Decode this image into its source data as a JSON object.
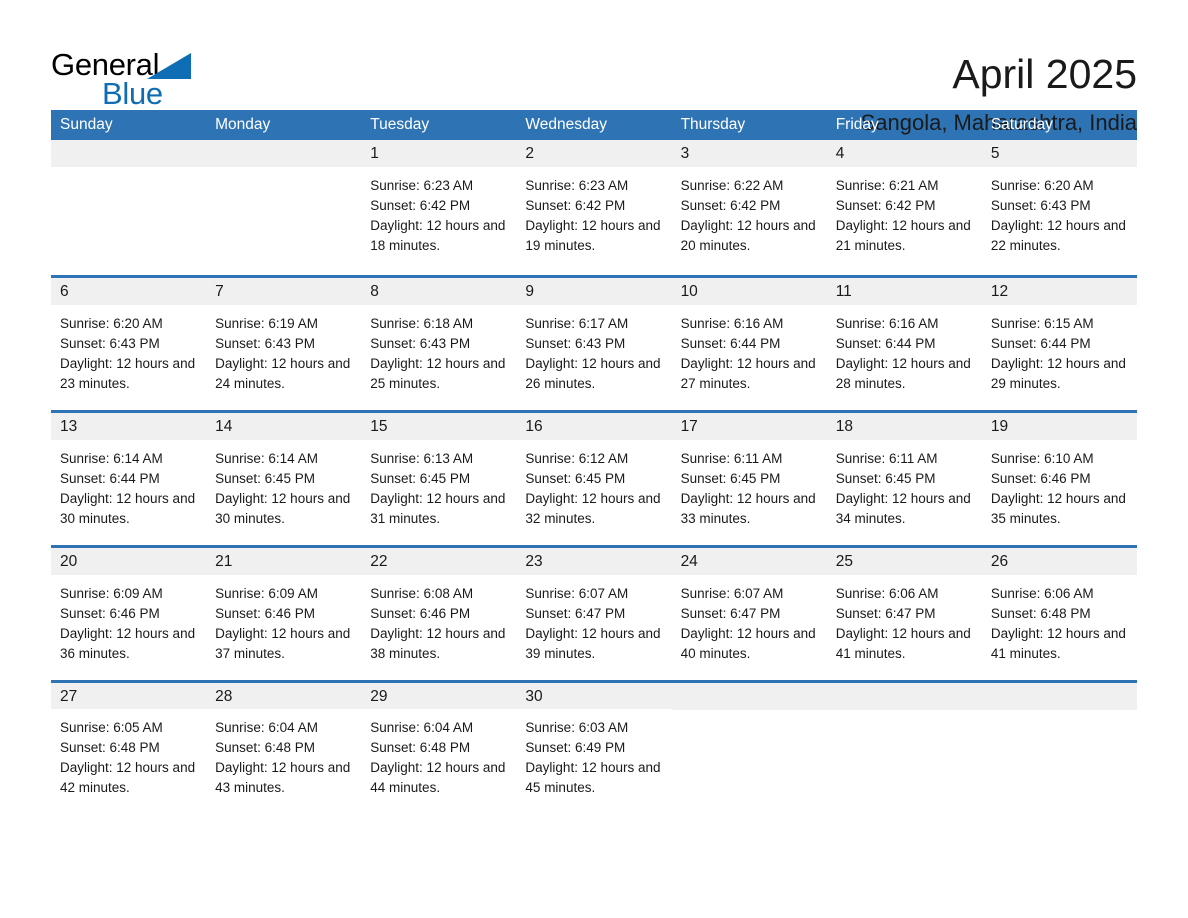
{
  "brand": {
    "logo_text_primary": "General",
    "logo_text_secondary": "Blue",
    "accent_color": "#2E74B5",
    "logo_blue": "#0F6DB5"
  },
  "header": {
    "month_title": "April 2025",
    "location": "Sangola, Maharashtra, India"
  },
  "calendar": {
    "weekday_headers": [
      "Sunday",
      "Monday",
      "Tuesday",
      "Wednesday",
      "Thursday",
      "Friday",
      "Saturday"
    ],
    "weeks": [
      [
        {
          "day": "",
          "empty": true
        },
        {
          "day": "",
          "empty": true
        },
        {
          "day": "1",
          "sunrise": "Sunrise: 6:23 AM",
          "sunset": "Sunset: 6:42 PM",
          "daylight": "Daylight: 12 hours and 18 minutes."
        },
        {
          "day": "2",
          "sunrise": "Sunrise: 6:23 AM",
          "sunset": "Sunset: 6:42 PM",
          "daylight": "Daylight: 12 hours and 19 minutes."
        },
        {
          "day": "3",
          "sunrise": "Sunrise: 6:22 AM",
          "sunset": "Sunset: 6:42 PM",
          "daylight": "Daylight: 12 hours and 20 minutes."
        },
        {
          "day": "4",
          "sunrise": "Sunrise: 6:21 AM",
          "sunset": "Sunset: 6:42 PM",
          "daylight": "Daylight: 12 hours and 21 minutes."
        },
        {
          "day": "5",
          "sunrise": "Sunrise: 6:20 AM",
          "sunset": "Sunset: 6:43 PM",
          "daylight": "Daylight: 12 hours and 22 minutes."
        }
      ],
      [
        {
          "day": "6",
          "sunrise": "Sunrise: 6:20 AM",
          "sunset": "Sunset: 6:43 PM",
          "daylight": "Daylight: 12 hours and 23 minutes."
        },
        {
          "day": "7",
          "sunrise": "Sunrise: 6:19 AM",
          "sunset": "Sunset: 6:43 PM",
          "daylight": "Daylight: 12 hours and 24 minutes."
        },
        {
          "day": "8",
          "sunrise": "Sunrise: 6:18 AM",
          "sunset": "Sunset: 6:43 PM",
          "daylight": "Daylight: 12 hours and 25 minutes."
        },
        {
          "day": "9",
          "sunrise": "Sunrise: 6:17 AM",
          "sunset": "Sunset: 6:43 PM",
          "daylight": "Daylight: 12 hours and 26 minutes."
        },
        {
          "day": "10",
          "sunrise": "Sunrise: 6:16 AM",
          "sunset": "Sunset: 6:44 PM",
          "daylight": "Daylight: 12 hours and 27 minutes."
        },
        {
          "day": "11",
          "sunrise": "Sunrise: 6:16 AM",
          "sunset": "Sunset: 6:44 PM",
          "daylight": "Daylight: 12 hours and 28 minutes."
        },
        {
          "day": "12",
          "sunrise": "Sunrise: 6:15 AM",
          "sunset": "Sunset: 6:44 PM",
          "daylight": "Daylight: 12 hours and 29 minutes."
        }
      ],
      [
        {
          "day": "13",
          "sunrise": "Sunrise: 6:14 AM",
          "sunset": "Sunset: 6:44 PM",
          "daylight": "Daylight: 12 hours and 30 minutes."
        },
        {
          "day": "14",
          "sunrise": "Sunrise: 6:14 AM",
          "sunset": "Sunset: 6:45 PM",
          "daylight": "Daylight: 12 hours and 30 minutes."
        },
        {
          "day": "15",
          "sunrise": "Sunrise: 6:13 AM",
          "sunset": "Sunset: 6:45 PM",
          "daylight": "Daylight: 12 hours and 31 minutes."
        },
        {
          "day": "16",
          "sunrise": "Sunrise: 6:12 AM",
          "sunset": "Sunset: 6:45 PM",
          "daylight": "Daylight: 12 hours and 32 minutes."
        },
        {
          "day": "17",
          "sunrise": "Sunrise: 6:11 AM",
          "sunset": "Sunset: 6:45 PM",
          "daylight": "Daylight: 12 hours and 33 minutes."
        },
        {
          "day": "18",
          "sunrise": "Sunrise: 6:11 AM",
          "sunset": "Sunset: 6:45 PM",
          "daylight": "Daylight: 12 hours and 34 minutes."
        },
        {
          "day": "19",
          "sunrise": "Sunrise: 6:10 AM",
          "sunset": "Sunset: 6:46 PM",
          "daylight": "Daylight: 12 hours and 35 minutes."
        }
      ],
      [
        {
          "day": "20",
          "sunrise": "Sunrise: 6:09 AM",
          "sunset": "Sunset: 6:46 PM",
          "daylight": "Daylight: 12 hours and 36 minutes."
        },
        {
          "day": "21",
          "sunrise": "Sunrise: 6:09 AM",
          "sunset": "Sunset: 6:46 PM",
          "daylight": "Daylight: 12 hours and 37 minutes."
        },
        {
          "day": "22",
          "sunrise": "Sunrise: 6:08 AM",
          "sunset": "Sunset: 6:46 PM",
          "daylight": "Daylight: 12 hours and 38 minutes."
        },
        {
          "day": "23",
          "sunrise": "Sunrise: 6:07 AM",
          "sunset": "Sunset: 6:47 PM",
          "daylight": "Daylight: 12 hours and 39 minutes."
        },
        {
          "day": "24",
          "sunrise": "Sunrise: 6:07 AM",
          "sunset": "Sunset: 6:47 PM",
          "daylight": "Daylight: 12 hours and 40 minutes."
        },
        {
          "day": "25",
          "sunrise": "Sunrise: 6:06 AM",
          "sunset": "Sunset: 6:47 PM",
          "daylight": "Daylight: 12 hours and 41 minutes."
        },
        {
          "day": "26",
          "sunrise": "Sunrise: 6:06 AM",
          "sunset": "Sunset: 6:48 PM",
          "daylight": "Daylight: 12 hours and 41 minutes."
        }
      ],
      [
        {
          "day": "27",
          "sunrise": "Sunrise: 6:05 AM",
          "sunset": "Sunset: 6:48 PM",
          "daylight": "Daylight: 12 hours and 42 minutes."
        },
        {
          "day": "28",
          "sunrise": "Sunrise: 6:04 AM",
          "sunset": "Sunset: 6:48 PM",
          "daylight": "Daylight: 12 hours and 43 minutes."
        },
        {
          "day": "29",
          "sunrise": "Sunrise: 6:04 AM",
          "sunset": "Sunset: 6:48 PM",
          "daylight": "Daylight: 12 hours and 44 minutes."
        },
        {
          "day": "30",
          "sunrise": "Sunrise: 6:03 AM",
          "sunset": "Sunset: 6:49 PM",
          "daylight": "Daylight: 12 hours and 45 minutes."
        },
        {
          "day": "",
          "empty": true
        },
        {
          "day": "",
          "empty": true
        },
        {
          "day": "",
          "empty": true
        }
      ]
    ]
  }
}
